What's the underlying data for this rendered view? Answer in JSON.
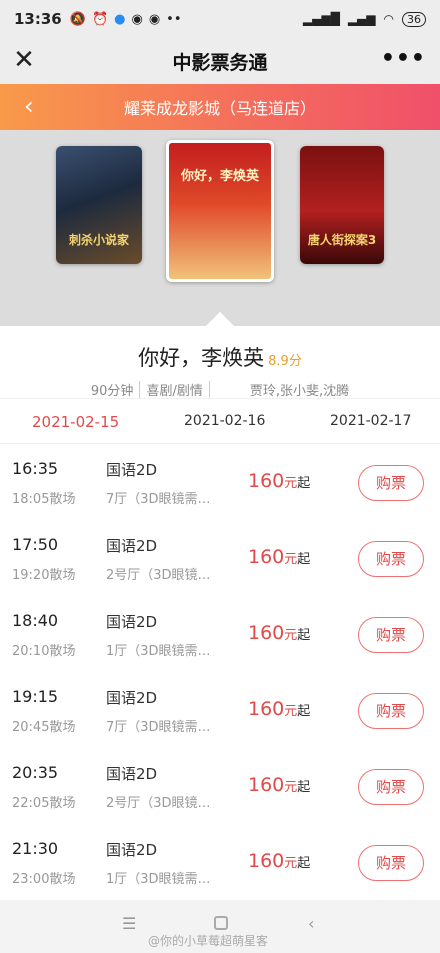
{
  "status_bar": {
    "time": "13:36",
    "left_icons": [
      "mute-bell-icon",
      "alarm-icon",
      "qq-icon",
      "weibo-icon",
      "weibo-icon",
      "more-dots-icon"
    ],
    "right_icons": [
      "signal-icon",
      "hd-signal-icon",
      "wifi-icon"
    ],
    "battery": "36"
  },
  "titlebar": {
    "title": "中影票务通"
  },
  "cinema": {
    "name": "耀莱成龙影城（马连道店）"
  },
  "posters": [
    {
      "text": "刺杀小说家"
    },
    {
      "text": "你好，李焕英"
    },
    {
      "text": "唐人街探案3"
    }
  ],
  "movie": {
    "title": "你好，李焕英",
    "score": "8.9分",
    "duration": "90分钟",
    "genre": "喜剧/剧情",
    "cast": "贾玲,张小斐,沈腾"
  },
  "dates": [
    "2021-02-15",
    "2021-02-16",
    "2021-02-17"
  ],
  "showtimes": [
    {
      "start": "16:35",
      "end": "18:05散场",
      "lang": "国语2D",
      "hall": "7厅（3D眼镜需…",
      "price": "160",
      "unit": "元",
      "qi": "起",
      "buy": "购票"
    },
    {
      "start": "17:50",
      "end": "19:20散场",
      "lang": "国语2D",
      "hall": "2号厅（3D眼镜…",
      "price": "160",
      "unit": "元",
      "qi": "起",
      "buy": "购票"
    },
    {
      "start": "18:40",
      "end": "20:10散场",
      "lang": "国语2D",
      "hall": "1厅（3D眼镜需…",
      "price": "160",
      "unit": "元",
      "qi": "起",
      "buy": "购票"
    },
    {
      "start": "19:15",
      "end": "20:45散场",
      "lang": "国语2D",
      "hall": "7厅（3D眼镜需…",
      "price": "160",
      "unit": "元",
      "qi": "起",
      "buy": "购票"
    },
    {
      "start": "20:35",
      "end": "22:05散场",
      "lang": "国语2D",
      "hall": "2号厅（3D眼镜…",
      "price": "160",
      "unit": "元",
      "qi": "起",
      "buy": "购票"
    },
    {
      "start": "21:30",
      "end": "23:00散场",
      "lang": "国语2D",
      "hall": "1厅（3D眼镜需…",
      "price": "160",
      "unit": "元",
      "qi": "起",
      "buy": "购票"
    }
  ],
  "watermark": "@你的小草莓超萌星客",
  "colors": {
    "accent": "#e04a4a",
    "score": "#e8a030",
    "banner_start": "#f89a4a",
    "banner_end": "#f0506a"
  }
}
